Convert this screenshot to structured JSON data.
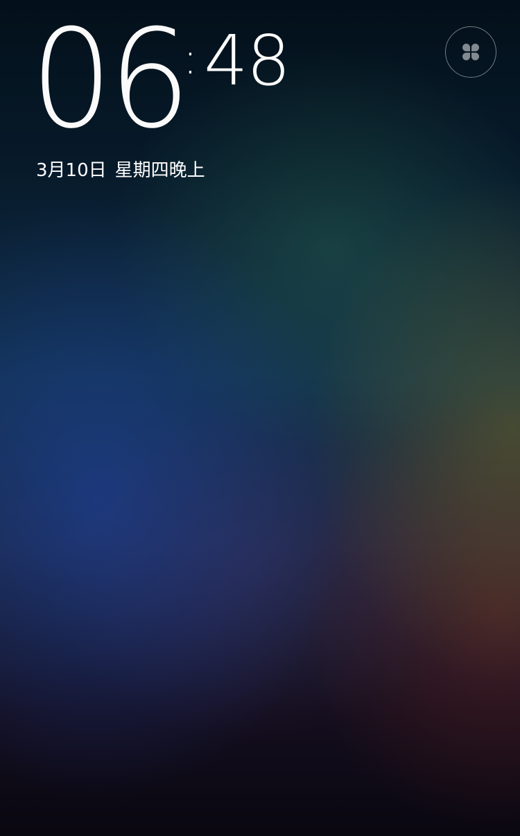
{
  "lockscreen": {
    "clock": {
      "hours": "06",
      "separator": ":",
      "minutes": "48"
    },
    "date": {
      "date": "3月10日",
      "weekday_period": "星期四晚上"
    },
    "top_right_button": {
      "icon": "clover-icon"
    }
  }
}
